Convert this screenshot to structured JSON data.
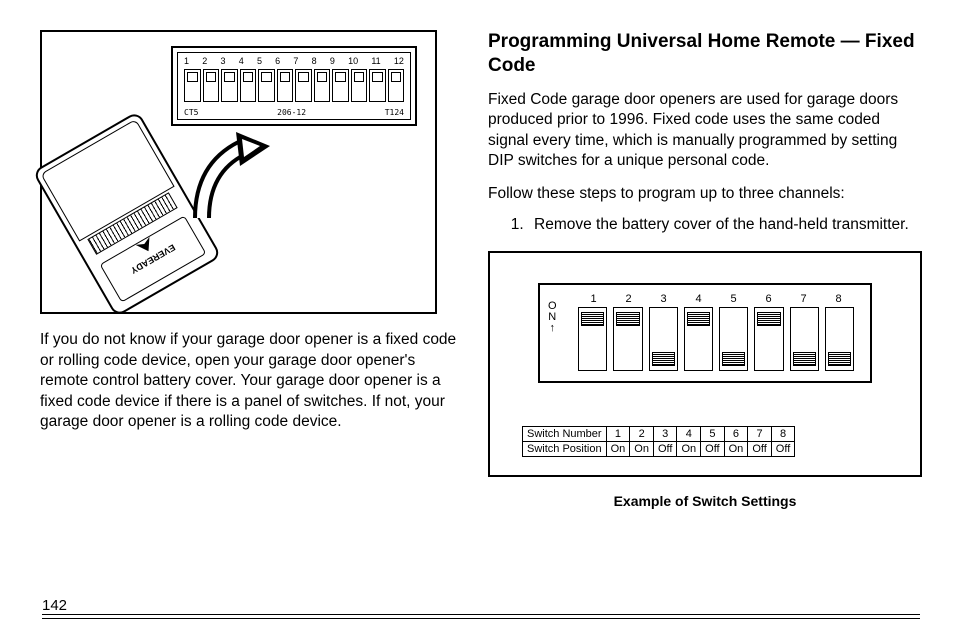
{
  "page_number": "142",
  "left_paragraph": "If you do not know if your garage door opener is a fixed code or rolling code device, open your garage door opener's remote control battery cover. Your garage door opener is a fixed code device if there is a panel of switches. If not, your garage door opener is a rolling code device.",
  "fig1": {
    "dip_numbers": [
      "1",
      "2",
      "3",
      "4",
      "5",
      "6",
      "7",
      "8",
      "9",
      "10",
      "11",
      "12"
    ],
    "dip_bottom_labels": [
      "CT5",
      "206-12",
      "T124"
    ],
    "remote_brand": "EVEREADY"
  },
  "heading": "Programming Universal Home Remote — Fixed Code",
  "intro": "Fixed Code garage door openers are used for garage doors produced prior to 1996. Fixed code uses the same coded signal every time, which is manually programmed by setting DIP switches for a unique personal code.",
  "follow": "Follow these steps to program up to three channels:",
  "steps": [
    "Remove the battery cover of the hand-held transmitter."
  ],
  "fig2": {
    "on_label": [
      "O",
      "N",
      "↑"
    ],
    "switch_numbers": [
      "1",
      "2",
      "3",
      "4",
      "5",
      "6",
      "7",
      "8"
    ],
    "switch_positions": [
      "On",
      "On",
      "Off",
      "On",
      "Off",
      "On",
      "Off",
      "Off"
    ],
    "row1_label": "Switch Number",
    "row2_label": "Switch Position",
    "caption": "Example of Switch Settings"
  },
  "chart_data": {
    "type": "table",
    "title": "Example of Switch Settings",
    "columns": [
      "Switch Number",
      "1",
      "2",
      "3",
      "4",
      "5",
      "6",
      "7",
      "8"
    ],
    "rows": [
      [
        "Switch Position",
        "On",
        "On",
        "Off",
        "On",
        "Off",
        "On",
        "Off",
        "Off"
      ]
    ]
  }
}
